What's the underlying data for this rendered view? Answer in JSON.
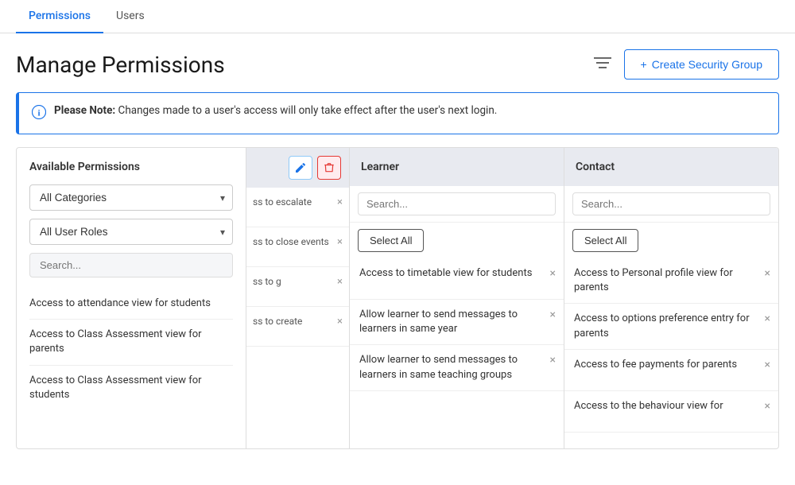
{
  "tabs": [
    {
      "id": "permissions",
      "label": "Permissions",
      "active": true
    },
    {
      "id": "users",
      "label": "Users",
      "active": false
    }
  ],
  "header": {
    "title": "Manage Permissions",
    "filter_icon": "≡",
    "create_btn_prefix": "+",
    "create_btn_label": "Create Security Group"
  },
  "notice": {
    "icon": "i",
    "bold_text": "Please Note:",
    "text": "  Changes made to a user's access will only take effect after the user's next login."
  },
  "sidebar": {
    "title": "Available Permissions",
    "categories_label": "All Categories",
    "user_roles_label": "All User Roles",
    "search_placeholder": "Search...",
    "items": [
      {
        "label": "Access to attendance view for students"
      },
      {
        "label": "Access to Class Assessment view for parents"
      },
      {
        "label": "Access to Class Assessment view for students"
      }
    ]
  },
  "mid_column": {
    "items": [
      {
        "text": "ss to escalate"
      },
      {
        "text": "ss to close events"
      },
      {
        "text": "ss to g"
      },
      {
        "text": "ss to create"
      }
    ]
  },
  "learner_column": {
    "title": "Learner",
    "search_placeholder": "Search...",
    "select_all_label": "Select All",
    "items": [
      {
        "text": "Access to timetable view for students"
      },
      {
        "text": "Allow learner to send messages to learners in same year"
      },
      {
        "text": "Allow learner to send messages to learners in same teaching groups"
      }
    ]
  },
  "contact_column": {
    "title": "Contact",
    "search_placeholder": "Search...",
    "select_all_label": "Select All",
    "items": [
      {
        "text": "Access to Personal profile view for parents"
      },
      {
        "text": "Access to options preference entry for parents"
      },
      {
        "text": "Access to fee payments for parents"
      },
      {
        "text": "Access to the behaviour view for"
      }
    ]
  },
  "icons": {
    "filter": "⊟",
    "edit": "✎",
    "delete": "🗑",
    "close": "×",
    "chevron_down": "▾"
  }
}
